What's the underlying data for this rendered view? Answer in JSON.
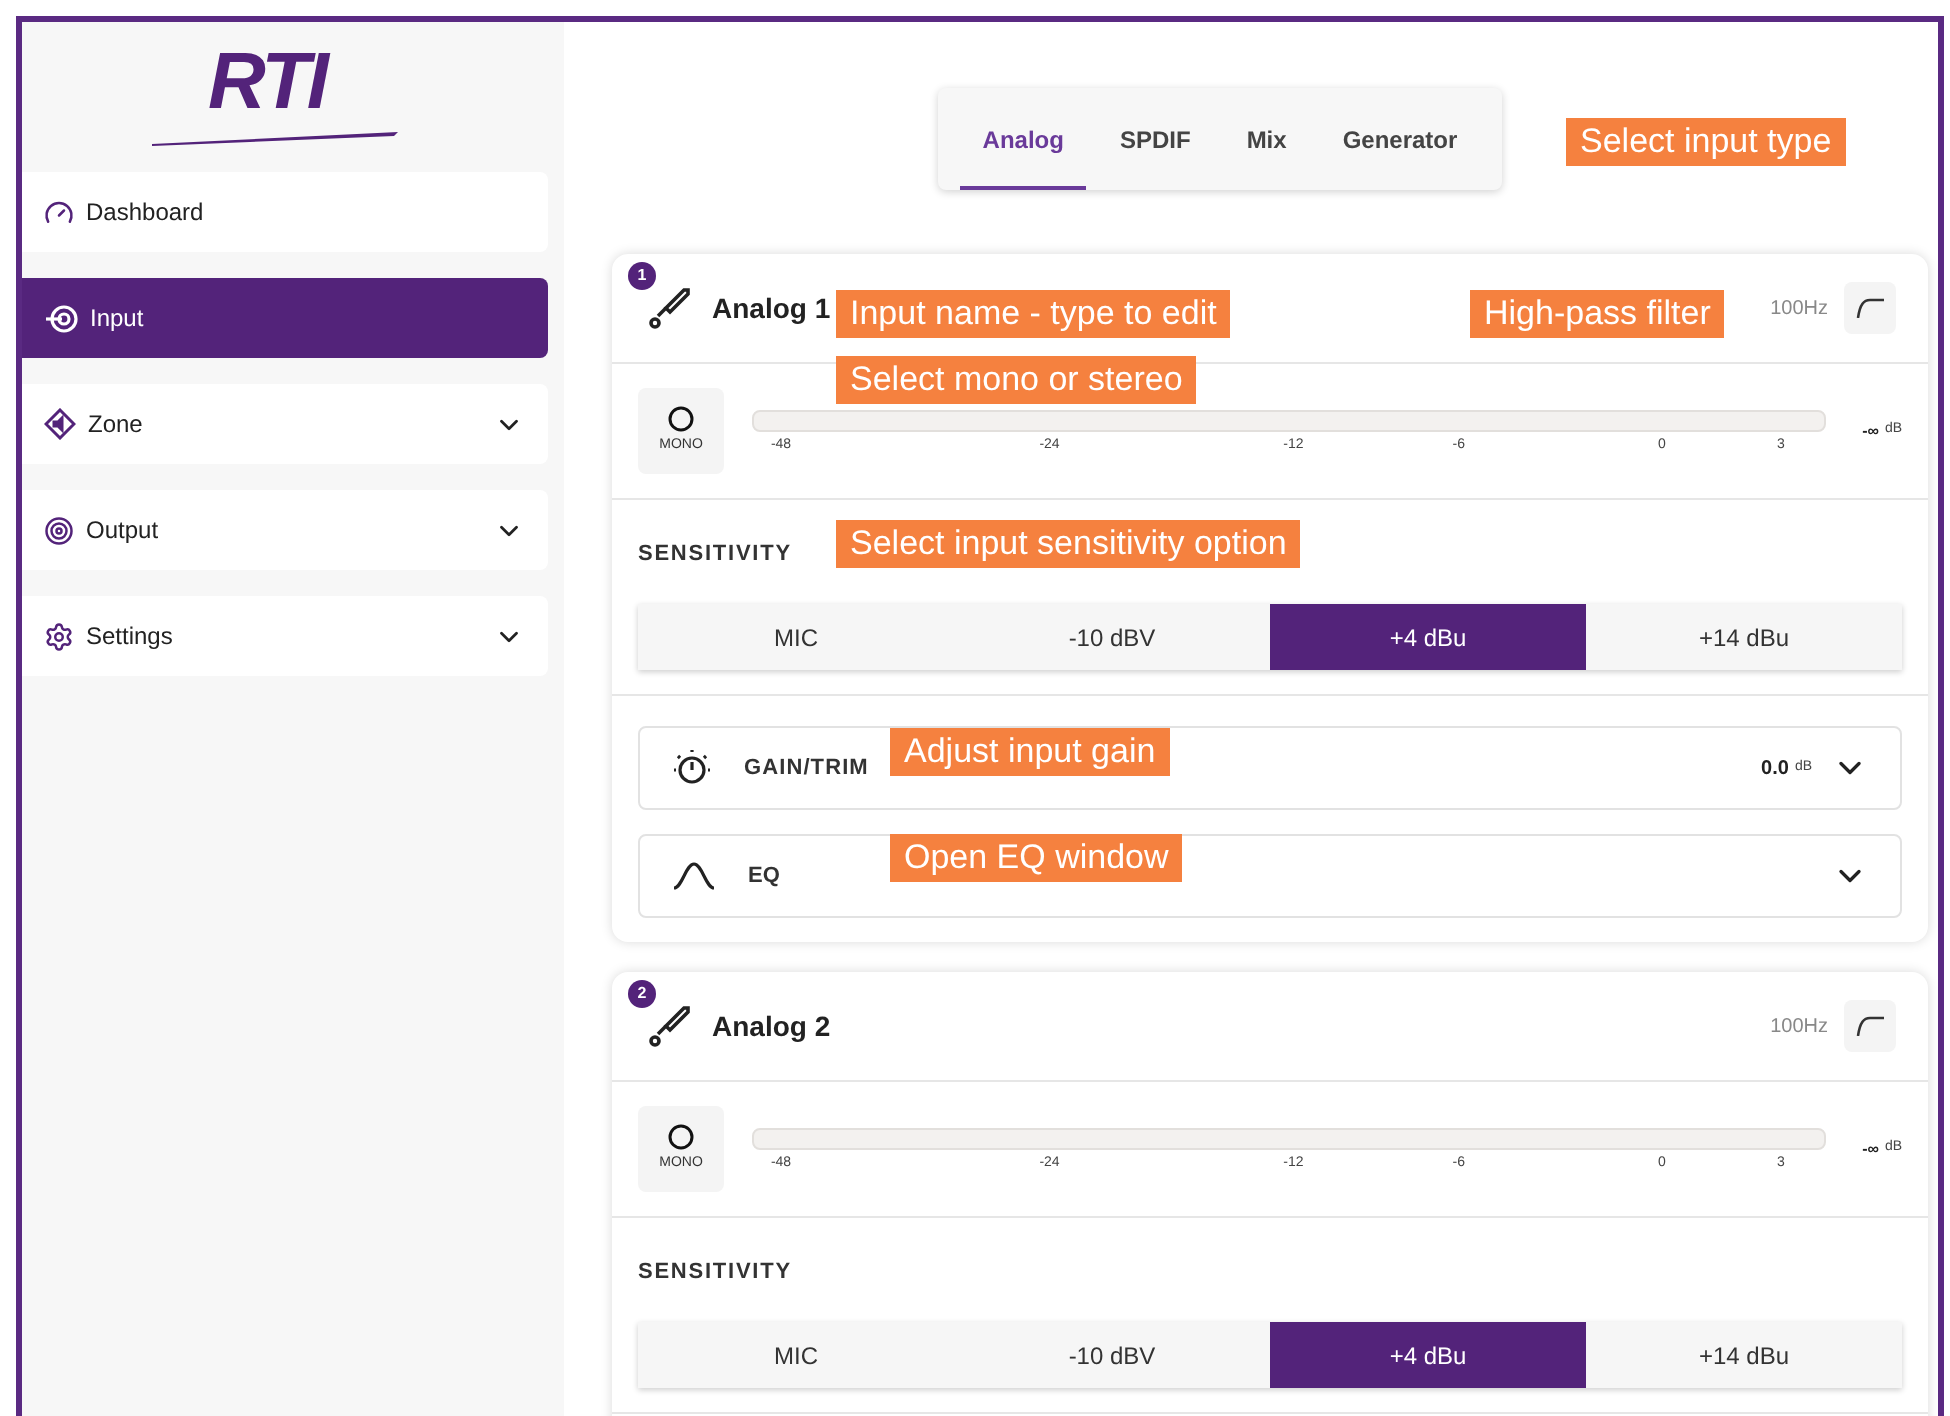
{
  "logo": "RTI",
  "sidebar": {
    "items": [
      {
        "label": "Dashboard",
        "selected": false,
        "expandable": false
      },
      {
        "label": "Input",
        "selected": true,
        "expandable": false
      },
      {
        "label": "Zone",
        "selected": false,
        "expandable": true
      },
      {
        "label": "Output",
        "selected": false,
        "expandable": true
      },
      {
        "label": "Settings",
        "selected": false,
        "expandable": true
      }
    ]
  },
  "tabs": [
    {
      "label": "Analog",
      "selected": true
    },
    {
      "label": "SPDIF",
      "selected": false
    },
    {
      "label": "Mix",
      "selected": false
    },
    {
      "label": "Generator",
      "selected": false
    }
  ],
  "inputs": [
    {
      "number": "1",
      "name": "Analog 1",
      "hpf": "100Hz",
      "mode": "MONO",
      "ticks": [
        "-48",
        "-24",
        "-12",
        "-6",
        "0",
        "3"
      ],
      "level": 0,
      "reading": "-∞",
      "reading_unit": "dB",
      "sensitivity_label": "SENSITIVITY",
      "sensitivity": [
        {
          "label": "MIC",
          "selected": false
        },
        {
          "label": "-10 dBV",
          "selected": false
        },
        {
          "label": "+4 dBu",
          "selected": true
        },
        {
          "label": "+14 dBu",
          "selected": false
        }
      ],
      "rows": [
        {
          "kind": "gain",
          "label": "GAIN/TRIM",
          "value": "0.0",
          "unit": "dB"
        },
        {
          "kind": "eq",
          "label": "EQ"
        }
      ]
    },
    {
      "number": "2",
      "name": "Analog 2",
      "hpf": "100Hz",
      "mode": "MONO",
      "ticks": [
        "-48",
        "-24",
        "-12",
        "-6",
        "0",
        "3"
      ],
      "level": 0,
      "reading": "-∞",
      "reading_unit": "dB",
      "sensitivity_label": "SENSITIVITY",
      "sensitivity": [
        {
          "label": "MIC",
          "selected": false
        },
        {
          "label": "-10 dBV",
          "selected": false
        },
        {
          "label": "+4 dBu",
          "selected": true
        },
        {
          "label": "+14 dBu",
          "selected": false
        }
      ]
    }
  ],
  "callouts": [
    "Select input type",
    "Input name - type to edit",
    "High-pass filter",
    "Select mono or stereo",
    "Select input sensitivity option",
    "Adjust input gain",
    "Open EQ window"
  ]
}
